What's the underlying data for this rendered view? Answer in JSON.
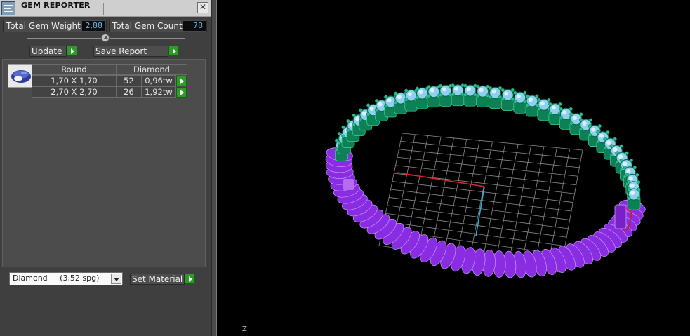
{
  "window": {
    "title": "GEM REPORTER",
    "close_glyph": "✕"
  },
  "summary": {
    "weight_label": "Total Gem Weight",
    "weight_value": "2,88",
    "count_label": "Total Gem Count",
    "count_value": "78",
    "slider_position": 0.5
  },
  "actions": {
    "update_label": "Update",
    "save_report_label": "Save Report"
  },
  "gem_table": {
    "thumbnail_icon": "round-gem-icon",
    "headers": [
      "Round",
      "Diamond"
    ],
    "rows": [
      {
        "size": "1,70 X 1,70",
        "count": "52",
        "weight": "0,96tw"
      },
      {
        "size": "2,70 X 2,70",
        "count": "26",
        "weight": "1,92tw"
      }
    ]
  },
  "material": {
    "selected": "Diamond     (3,52 spg)",
    "set_material_label": "Set Material"
  },
  "viewport": {
    "axis_label": "Z",
    "background": "#000000",
    "grid_color": "#8a8a8a",
    "x_axis_color": "#d8262a",
    "y_axis_color": "#2fb1d8",
    "stone_color": "#8fd0f0",
    "setting_color": "#0d8055",
    "band_color": "#8a2ce2"
  },
  "colors": {
    "go_button": "#2f9a28",
    "value_text": "#60b8e8"
  }
}
